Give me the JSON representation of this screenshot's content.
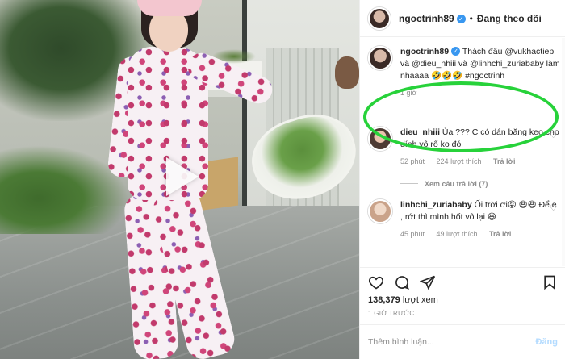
{
  "header": {
    "username": "ngoctrinh89",
    "separator": "•",
    "follow_status": "Đang theo dõi"
  },
  "caption": {
    "username": "ngoctrinh89",
    "text": " Thách đấu @vukhactiep và @dieu_nhiii và @linhchi_zuriababy làm nhaaaa 🤣🤣🤣 #ngoctrinh",
    "time": "1 giờ"
  },
  "comments": [
    {
      "username": "dieu_nhiii",
      "text": " Ủa ??? C có dán băng keo cho dính vô rổ ko đó",
      "time": "52 phút",
      "likes": "224 lượt thích",
      "reply_label": "Trả lời"
    },
    {
      "username": "linhchi_zuriababy",
      "text": " Ối trời ơi😝 😆😆 Để e , rớt thì mình hốt vô lại 😆",
      "time": "45 phút",
      "likes": "49 lượt thích",
      "reply_label": "Trả lời"
    }
  ],
  "view_replies": "Xem câu trả lời (7)",
  "actions": {
    "like_icon": "heart-icon",
    "comment_icon": "comment-icon",
    "share_icon": "share-icon",
    "save_icon": "bookmark-icon"
  },
  "views": {
    "count": "138,379",
    "label": " lượt xem"
  },
  "timestamp": "1 GIỜ TRƯỚC",
  "compose": {
    "placeholder": "Thêm bình luận...",
    "post_label": "Đăng"
  },
  "colors": {
    "accent": "#3897f0",
    "highlight": "#27d23a",
    "post_disabled": "#b3dbff"
  }
}
